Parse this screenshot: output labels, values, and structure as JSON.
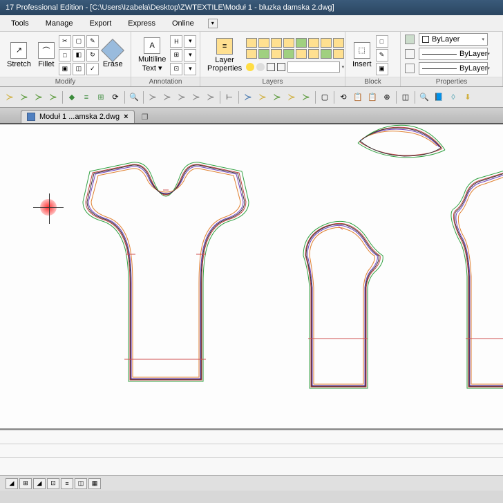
{
  "title_bar": "17 Professional Edition - [C:\\Users\\Izabela\\Desktop\\ZWTEXTILE\\Moduł 1 - bluzka damska 2.dwg]",
  "menu": {
    "items": [
      "Tools",
      "Manage",
      "Export",
      "Express",
      "Online"
    ]
  },
  "ribbon": {
    "modify": {
      "label": "Modify",
      "stretch": "Stretch",
      "fillet": "Fillet",
      "erase": "Erase"
    },
    "annotation": {
      "label": "Annotation",
      "mtext": "Multiline\nText ▾"
    },
    "layers": {
      "label": "Layers",
      "props": "Layer\nProperties"
    },
    "block": {
      "label": "Block",
      "insert": "Insert"
    },
    "properties": {
      "label": "Properties",
      "bylayer": "ByLayer"
    }
  },
  "tabs": {
    "file": "Moduł 1 ...amska 2.dwg"
  }
}
